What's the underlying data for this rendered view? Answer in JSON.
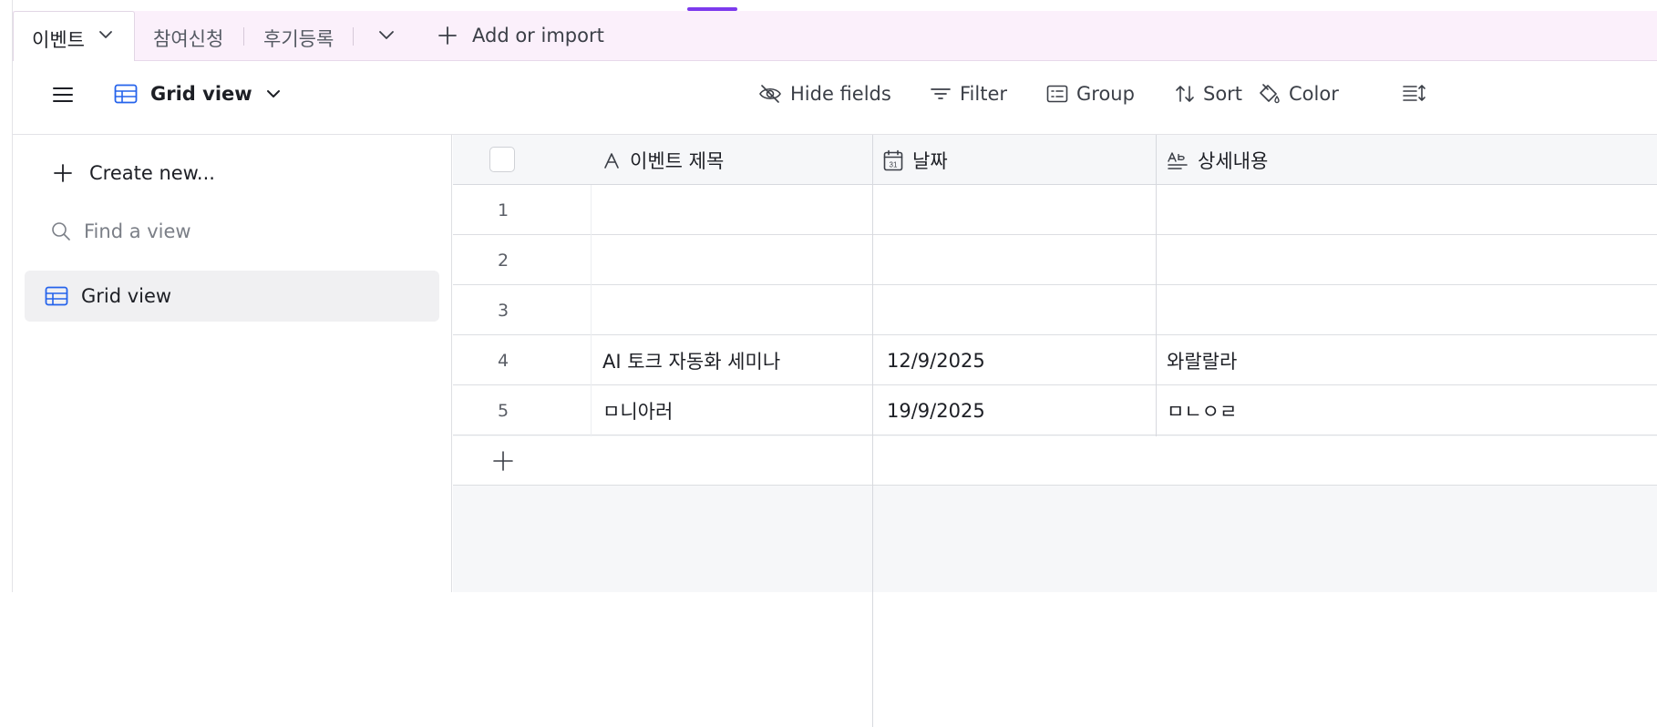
{
  "tabs": {
    "active": "이벤트",
    "others": [
      "참여신청",
      "후기등록"
    ],
    "add_import": "Add or import"
  },
  "toolbar": {
    "view_name": "Grid view",
    "buttons": [
      {
        "label": "Hide fields",
        "icon": "eye-off-icon"
      },
      {
        "label": "Filter",
        "icon": "filter-icon"
      },
      {
        "label": "Group",
        "icon": "group-icon"
      },
      {
        "label": "Sort",
        "icon": "sort-icon"
      },
      {
        "label": "Color",
        "icon": "paint-bucket-icon"
      }
    ]
  },
  "sidebar": {
    "create_new": "Create new...",
    "search_placeholder": "Find a view",
    "views": [
      {
        "label": "Grid view",
        "icon": "grid-view-icon"
      }
    ]
  },
  "grid": {
    "columns": [
      {
        "label": "이벤트 제목",
        "icon": "text-field-icon"
      },
      {
        "label": "날짜",
        "icon": "calendar-icon"
      },
      {
        "label": "상세내용",
        "icon": "long-text-icon"
      }
    ],
    "rows": [
      {
        "num": "1",
        "cells": [
          "",
          "",
          ""
        ]
      },
      {
        "num": "2",
        "cells": [
          "",
          "",
          ""
        ]
      },
      {
        "num": "3",
        "cells": [
          "",
          "",
          ""
        ]
      },
      {
        "num": "4",
        "cells": [
          "AI 토크 자동화 세미나",
          "12/9/2025",
          "와랄랄라"
        ]
      },
      {
        "num": "5",
        "cells": [
          "ㅁ니아러",
          "19/9/2025",
          "ㅁㄴㅇㄹ"
        ]
      }
    ]
  },
  "colors": {
    "accent": "#7c3aed",
    "tabbar_bg": "#fbf0fb",
    "view_icon": "#2563eb",
    "selected_view_bg": "#f0f0f2"
  }
}
